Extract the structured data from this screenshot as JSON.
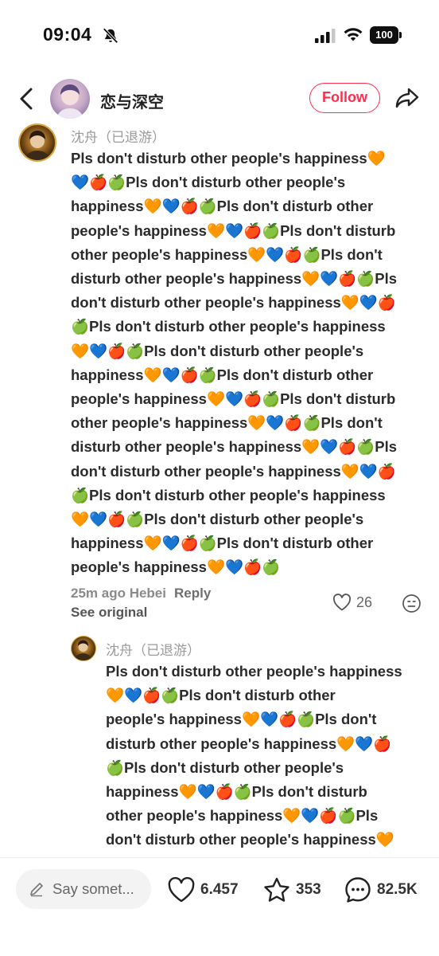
{
  "status_bar": {
    "time": "09:04",
    "battery": "100"
  },
  "header": {
    "username": "恋与深空",
    "follow_label": "Follow"
  },
  "comments": [
    {
      "username": "沈舟（已退游）",
      "lines": [
        "Pls don't disturb other people's happiness🧡",
        "💙🍎🍏Pls don't disturb other people's",
        "happiness🧡💙🍎🍏Pls don't disturb other",
        "people's happiness🧡💙🍎🍏Pls don't disturb",
        "other people's happiness🧡💙🍎🍏Pls don't",
        "disturb other people's happiness🧡💙🍎🍏Pls",
        "don't disturb other people's happiness🧡💙🍎",
        "🍏Pls don't disturb other people's happiness",
        "🧡💙🍎🍏Pls don't disturb other people's",
        "happiness🧡💙🍎🍏Pls don't disturb other",
        "people's happiness🧡💙🍎🍏Pls don't disturb",
        "other people's happiness🧡💙🍎🍏Pls don't",
        "disturb other people's happiness🧡💙🍎🍏Pls",
        "don't disturb other people's happiness🧡💙🍎",
        "🍏Pls don't disturb other people's happiness",
        "🧡💙🍎🍏Pls don't disturb other people's",
        "happiness🧡💙🍎🍏Pls don't disturb other",
        "people's happiness🧡💙🍎🍏"
      ],
      "meta": "25m ago Hebei",
      "reply_label": "Reply",
      "see_original": "See original",
      "likes": "26"
    },
    {
      "username": "沈舟（已退游）",
      "lines": [
        "Pls don't disturb other people's happiness",
        "🧡💙🍎🍏Pls don't disturb other",
        "people's happiness🧡💙🍎🍏Pls don't",
        "disturb other people's happiness🧡💙🍎",
        "🍏Pls don't disturb other people's",
        "happiness🧡💙🍎🍏Pls don't disturb",
        "other people's happiness🧡💙🍎🍏Pls",
        "don't disturb other people's happiness🧡"
      ]
    }
  ],
  "bottom_bar": {
    "input_placeholder": "Say somet...",
    "likes": "6.457",
    "stars": "353",
    "comments": "82.5K"
  },
  "colors": {
    "accent": "#ff2e4d",
    "text": "#2b2b2b",
    "muted": "#8a8a8a"
  }
}
